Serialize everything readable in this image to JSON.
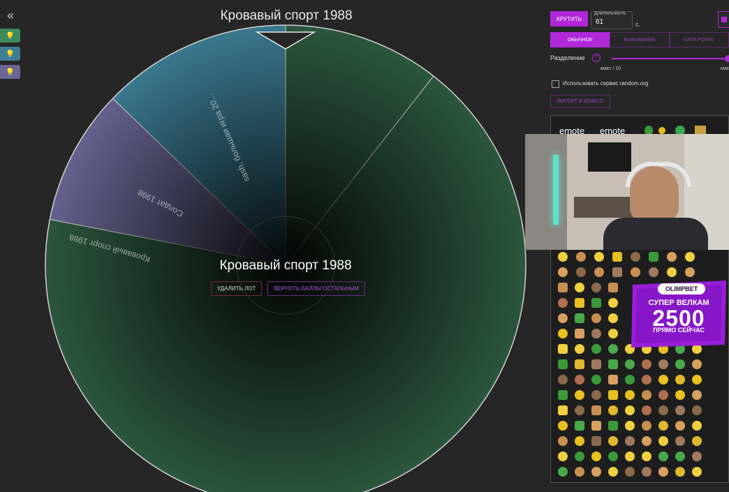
{
  "title": "Кровавый спорт 1988",
  "collapse_icon": "«",
  "winner": "Кровавый спорт 1988",
  "buttons": {
    "delete_lot": "УДАЛИТЬ ЛОТ",
    "return_points": "ВЕРНУТЬ БАЛЛЫ ОСТАЛЬНЫМ"
  },
  "controls": {
    "spin": "КРУТИТЬ",
    "duration_label": "Длительность",
    "duration_value": "61",
    "duration_unit": "с.",
    "modes": [
      "ОБЫЧНОЕ",
      "ВЫБЫВАНИЕ",
      "БАТЛ РОЯЛЬ"
    ],
    "active_mode": 0,
    "split_label": "Разделение",
    "split_value": "макс / 10",
    "split_max": "мак",
    "random_org": "Использовать сервис random.org",
    "import": "ИМПОРТ В КОЛЕСО"
  },
  "emote_alt": "emote",
  "promo": {
    "brand": "OLIMPBET",
    "line1": "СУПЕР ВЕЛКАМ",
    "amount": "2500",
    "line2": "ПРЯМО СЕЙЧАС"
  },
  "chart_data": {
    "type": "pie",
    "title": "Кровавый спорт 1988",
    "slices": [
      {
        "label": "Кровавый спорт 1988",
        "value": 243,
        "color": "#2e5a40"
      },
      {
        "label": "Солдат 1998",
        "value": 33,
        "color": "#6a6694"
      },
      {
        "label": "sash, большая игра 20...",
        "value": 46,
        "color": "#3d7e95"
      },
      {
        "label": "Кровавый спорт 1988",
        "value": 38,
        "color": "#2e5a40"
      }
    ],
    "colors": {
      "dark": "#2e5a40",
      "purple": "#6a6694",
      "blue": "#3d7e95",
      "accent": "#b028d8"
    }
  }
}
